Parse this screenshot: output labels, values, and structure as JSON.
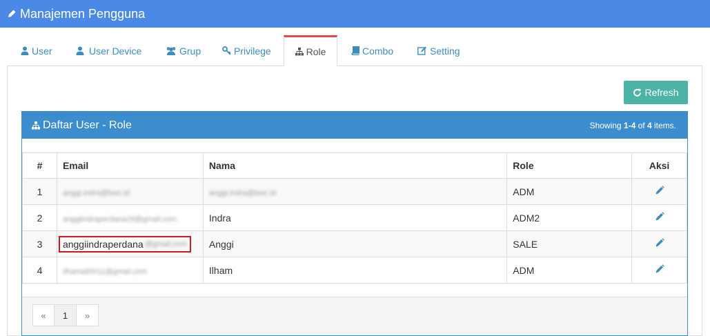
{
  "header": {
    "title": "Manajemen Pengguna"
  },
  "tabs": [
    {
      "label": "User",
      "icon": "user-icon"
    },
    {
      "label": "User Device",
      "icon": "user-icon"
    },
    {
      "label": "Grup",
      "icon": "users-icon"
    },
    {
      "label": "Privilege",
      "icon": "key-icon"
    },
    {
      "label": "Role",
      "icon": "sitemap-icon",
      "active": true
    },
    {
      "label": "Combo",
      "icon": "book-icon"
    },
    {
      "label": "Setting",
      "icon": "edit-icon"
    }
  ],
  "toolbar": {
    "refresh_label": "Refresh"
  },
  "panel": {
    "title": "Daftar User - Role",
    "summary": {
      "prefix": "Showing ",
      "range": "1-4",
      "of": " of ",
      "total": "4",
      "suffix": " items."
    }
  },
  "table": {
    "columns": [
      "#",
      "Email",
      "Nama",
      "Role",
      "Aksi"
    ],
    "rows": [
      {
        "num": "1",
        "email_masked": "anggi.indra@bwc.id",
        "nama_masked": "anggi.indra@bwc.id",
        "role": "ADM"
      },
      {
        "num": "2",
        "email_masked": "anggiindraperdana29@gmail.com",
        "nama": "Indra",
        "role": "ADM2"
      },
      {
        "num": "3",
        "email_visible": "anggiindraperdana",
        "email_masked": "@gmail.com",
        "nama": "Anggi",
        "role": "SALE"
      },
      {
        "num": "4",
        "email_masked": "ilhamali0011@gmail.com",
        "nama": "Ilham",
        "role": "ADM"
      }
    ]
  },
  "pagination": {
    "prev": "«",
    "page": "1",
    "next": "»"
  },
  "colors": {
    "header": "#4a8ae6",
    "panel_heading": "#3c8dcd",
    "refresh_button": "#4cb3a6",
    "active_tab_border": "#dd4b4b",
    "highlight": "#d0191f"
  }
}
